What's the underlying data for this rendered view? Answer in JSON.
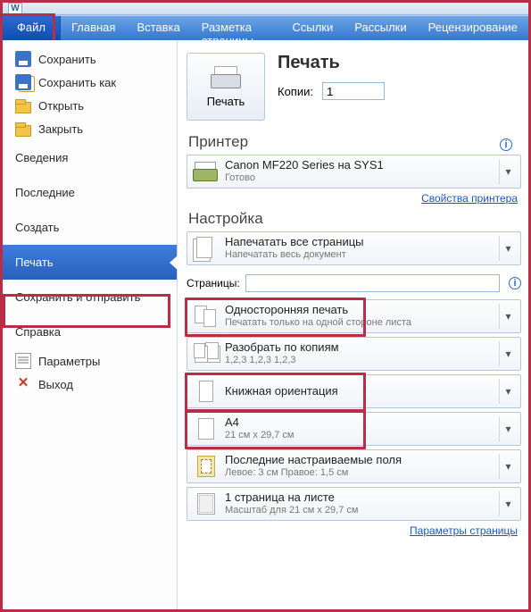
{
  "app": {
    "letter": "W"
  },
  "ribbon": {
    "file": "Файл",
    "tabs": [
      "Главная",
      "Вставка",
      "Разметка страницы",
      "Ссылки",
      "Рассылки",
      "Рецензирование"
    ]
  },
  "nav": {
    "save": "Сохранить",
    "saveas": "Сохранить как",
    "open": "Открыть",
    "close": "Закрыть",
    "info": "Сведения",
    "recent": "Последние",
    "newdoc": "Создать",
    "print": "Печать",
    "saveandsend": "Сохранить и отправить",
    "help": "Справка",
    "options": "Параметры",
    "exit": "Выход"
  },
  "print": {
    "title": "Печать",
    "button": "Печать",
    "copies_label": "Копии:",
    "copies_value": "1"
  },
  "printer": {
    "section": "Принтер",
    "name": "Canon MF220 Series на SYS1",
    "status": "Готово",
    "properties": "Свойства принтера"
  },
  "settings": {
    "section": "Настройка",
    "printall": {
      "t": "Напечатать все страницы",
      "s": "Напечатать весь документ"
    },
    "pages_label": "Страницы:",
    "pages_value": "",
    "duplex": {
      "t": "Односторонняя печать",
      "s": "Печатать только на одной стороне листа"
    },
    "collate": {
      "t": "Разобрать по копиям",
      "s": "1,2,3    1,2,3    1,2,3"
    },
    "orientation": {
      "t": "Книжная ориентация"
    },
    "paper": {
      "t": "A4",
      "s": "21 см x 29,7 см"
    },
    "margins": {
      "t": "Последние настраиваемые поля",
      "s": "Левое:  3 см     Правое:  1,5 см"
    },
    "persheet": {
      "t": "1 страница на листе",
      "s": "Масштаб для 21 см x 29,7 см"
    },
    "pagesetup": "Параметры страницы"
  },
  "info_icon": "i",
  "caret": "▾"
}
